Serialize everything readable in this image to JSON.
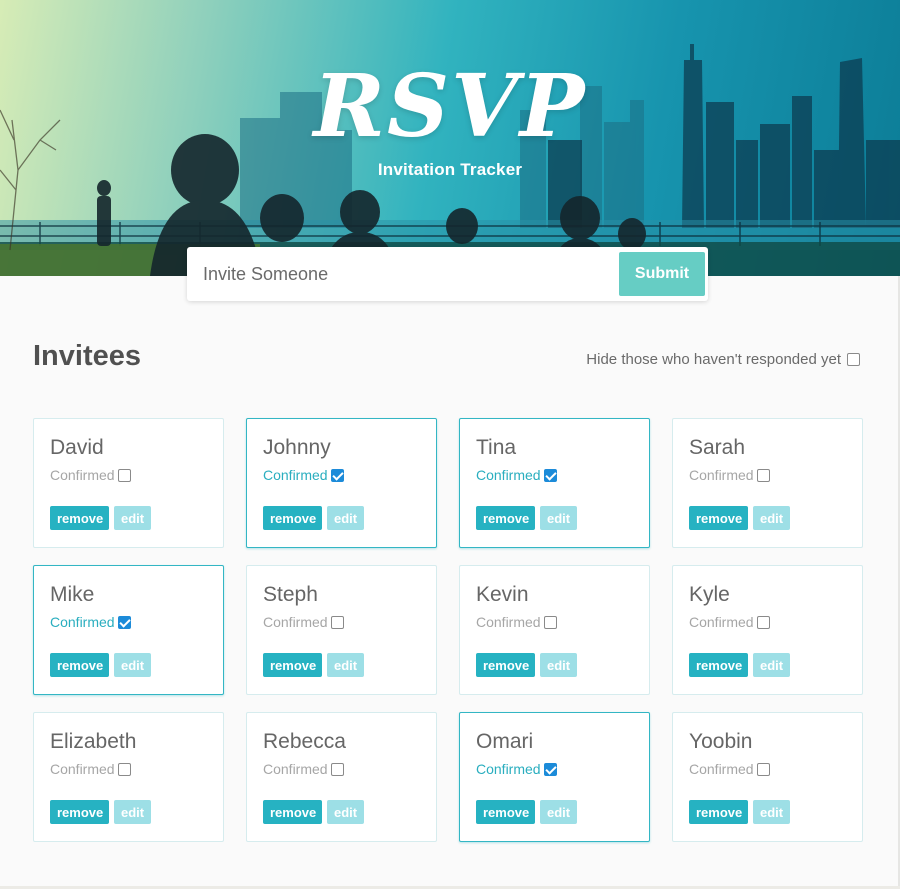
{
  "header": {
    "title": "RSVP",
    "subtitle": "Invitation Tracker"
  },
  "invite_form": {
    "placeholder": "Invite Someone",
    "submit_label": "Submit"
  },
  "invitees": {
    "heading": "Invitees",
    "filter_label": "Hide those who haven't responded yet",
    "filter_checked": false,
    "status_label": "Confirmed",
    "remove_label": "remove",
    "edit_label": "edit",
    "list": [
      {
        "name": "David",
        "confirmed": false
      },
      {
        "name": "Johnny",
        "confirmed": true
      },
      {
        "name": "Tina",
        "confirmed": true
      },
      {
        "name": "Sarah",
        "confirmed": false
      },
      {
        "name": "Mike",
        "confirmed": true
      },
      {
        "name": "Steph",
        "confirmed": false
      },
      {
        "name": "Kevin",
        "confirmed": false
      },
      {
        "name": "Kyle",
        "confirmed": false
      },
      {
        "name": "Elizabeth",
        "confirmed": false
      },
      {
        "name": "Rebecca",
        "confirmed": false
      },
      {
        "name": "Omari",
        "confirmed": true
      },
      {
        "name": "Yoobin",
        "confirmed": false
      }
    ]
  },
  "colors": {
    "accent": "#26b2c2",
    "submit": "#66cdc4",
    "edit": "#9ddfe6",
    "checkbox_checked": "#1c8bd9"
  }
}
